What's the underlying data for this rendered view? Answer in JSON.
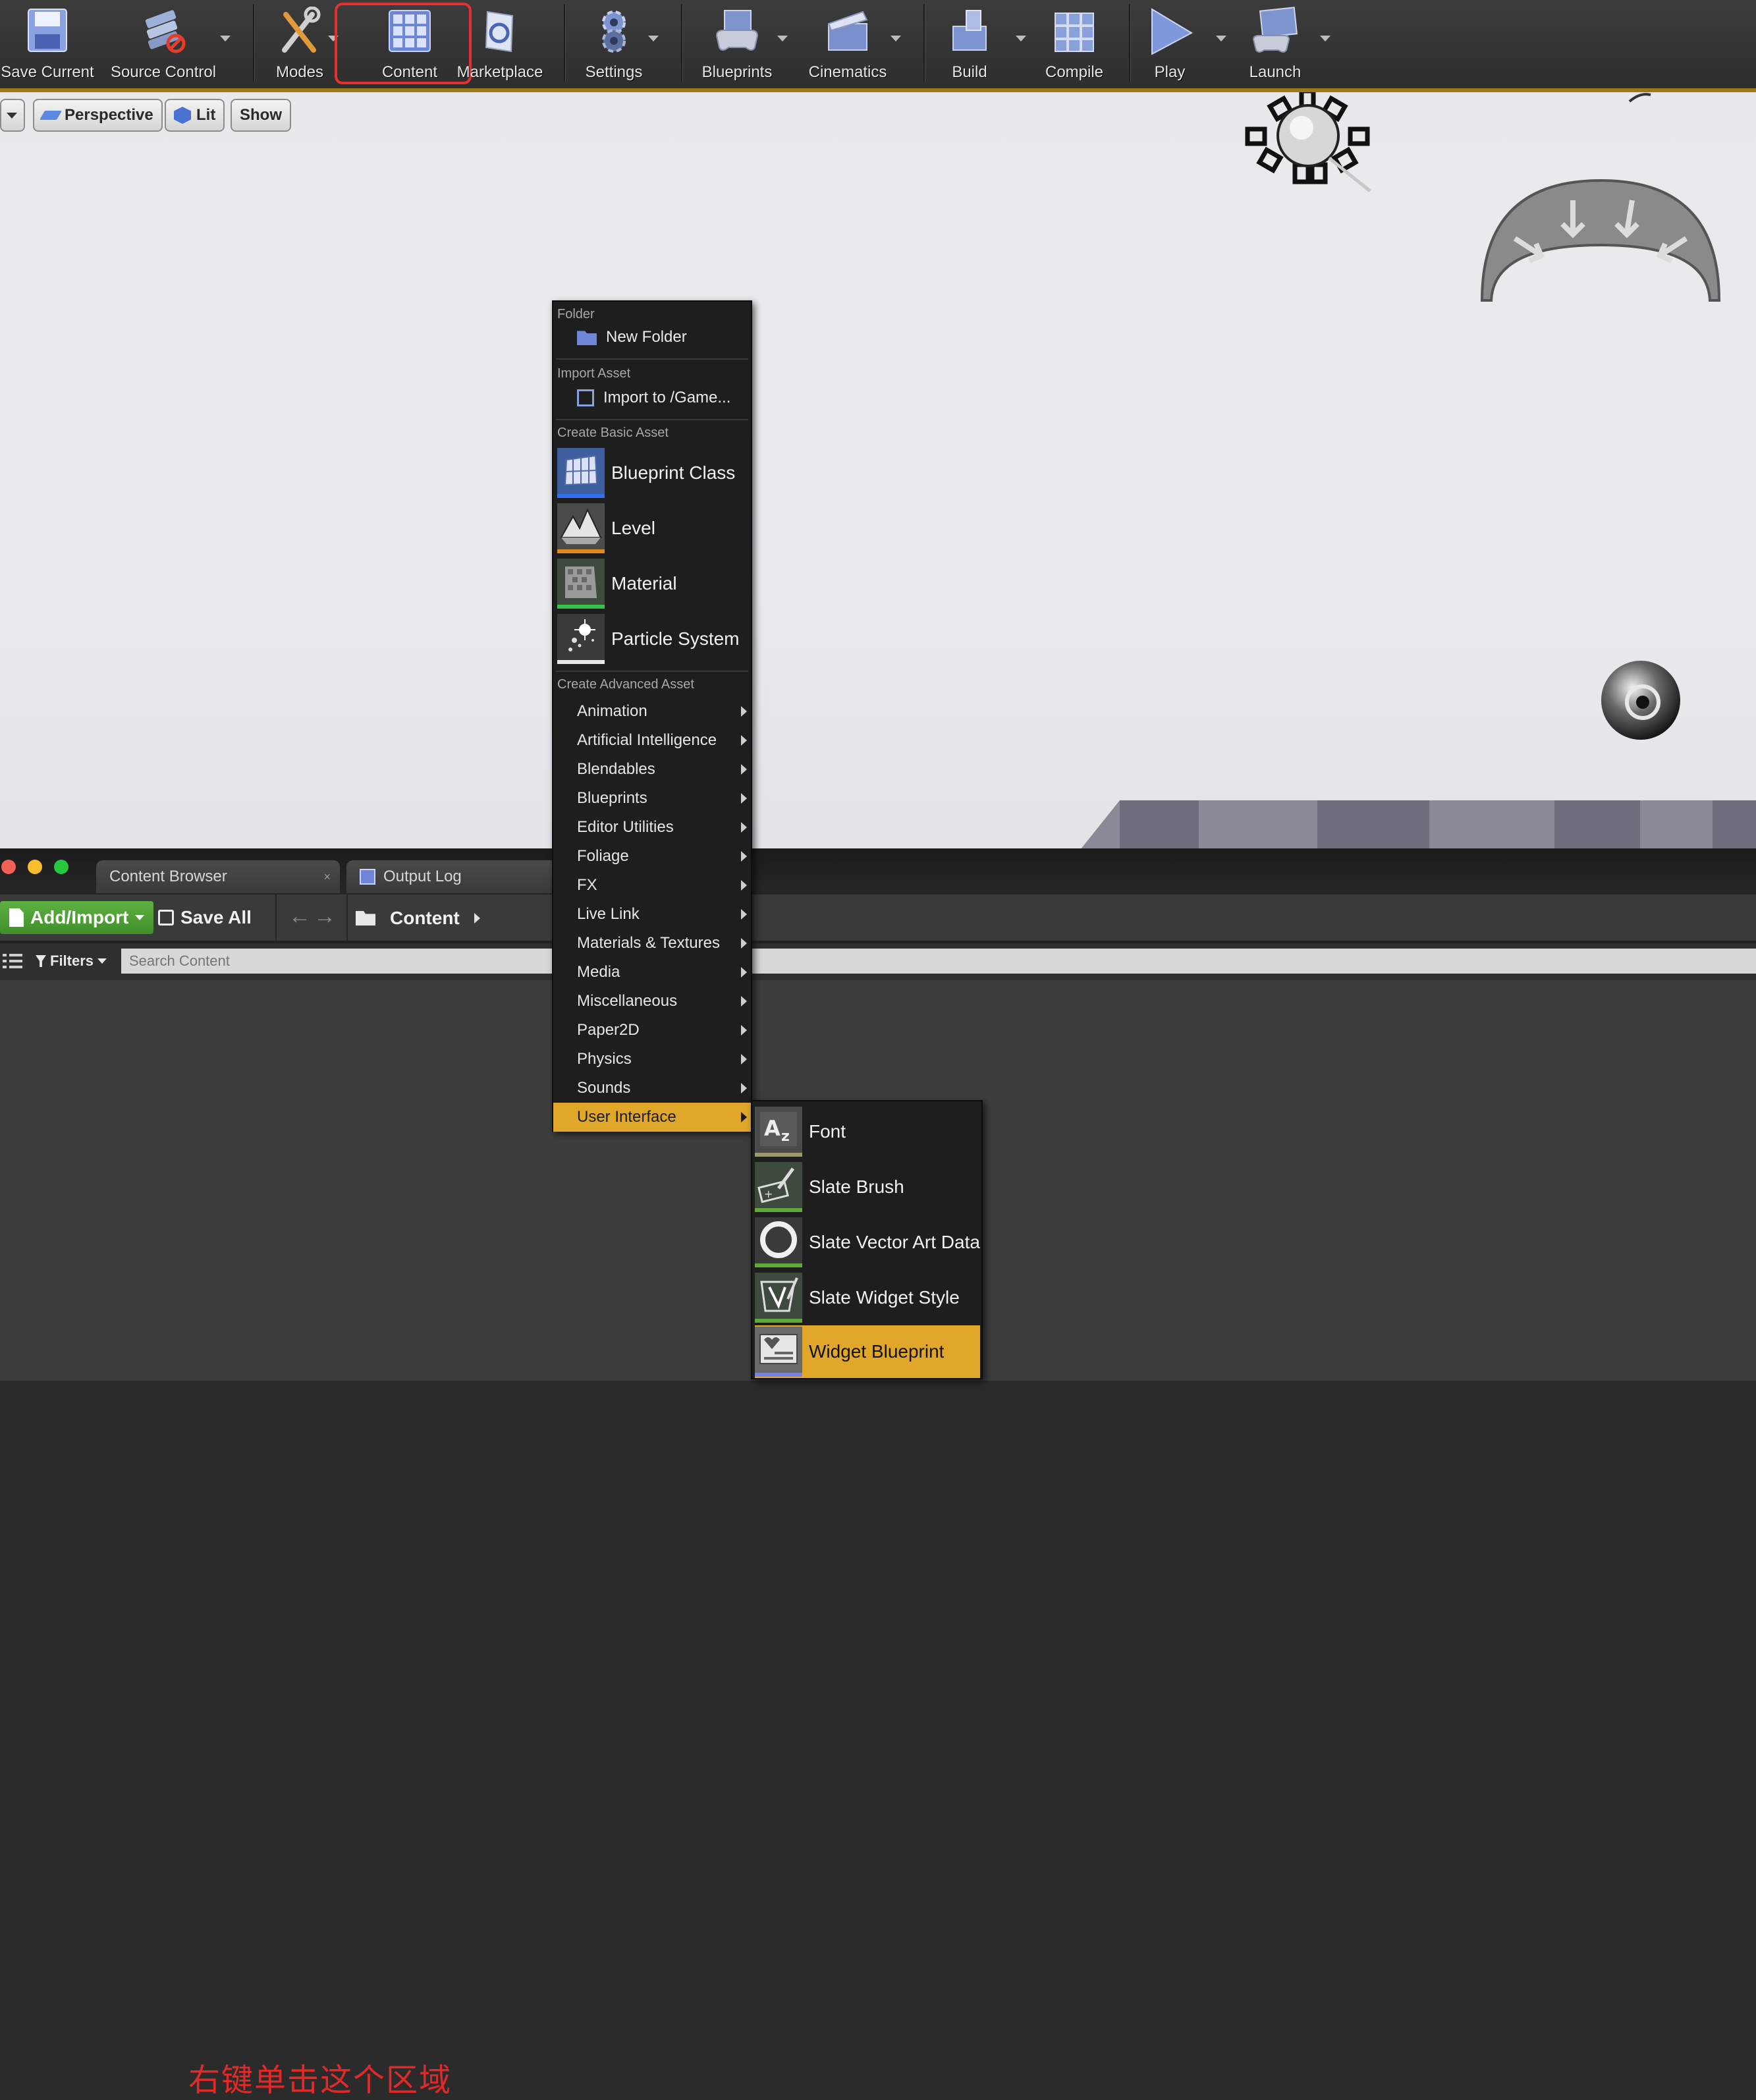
{
  "toolbar": {
    "save_current": "Save Current",
    "source_control": "Source Control",
    "modes": "Modes",
    "content": "Content",
    "marketplace": "Marketplace",
    "settings": "Settings",
    "blueprints": "Blueprints",
    "cinematics": "Cinematics",
    "build": "Build",
    "compile": "Compile",
    "play": "Play",
    "launch": "Launch"
  },
  "viewport": {
    "perspective": "Perspective",
    "lit": "Lit",
    "show": "Show"
  },
  "content_browser": {
    "tab_content_browser": "Content Browser",
    "tab_output_log": "Output Log",
    "add_import": "Add/Import",
    "save_all": "Save All",
    "path_root": "Content",
    "filters": "Filters",
    "search_placeholder": "Search Content",
    "note": "右键单击这个区域"
  },
  "context_menu": {
    "folder_header": "Folder",
    "new_folder": "New Folder",
    "import_header": "Import Asset",
    "import_to": "Import to /Game...",
    "basic_header": "Create Basic Asset",
    "basic": [
      "Blueprint Class",
      "Level",
      "Material",
      "Particle System"
    ],
    "advanced_header": "Create Advanced Asset",
    "advanced": [
      "Animation",
      "Artificial Intelligence",
      "Blendables",
      "Blueprints",
      "Editor Utilities",
      "Foliage",
      "FX",
      "Live Link",
      "Materials & Textures",
      "Media",
      "Miscellaneous",
      "Paper2D",
      "Physics",
      "Sounds",
      "User Interface"
    ],
    "active_advanced": "User Interface"
  },
  "submenu": {
    "items": [
      "Font",
      "Slate Brush",
      "Slate Vector Art Data",
      "Slate Widget Style",
      "Widget Blueprint"
    ],
    "active": "Widget Blueprint"
  },
  "colors": {
    "accent": "#e0a72b",
    "highlight_box": "#e53030",
    "add_import_green": "#4fa136"
  }
}
